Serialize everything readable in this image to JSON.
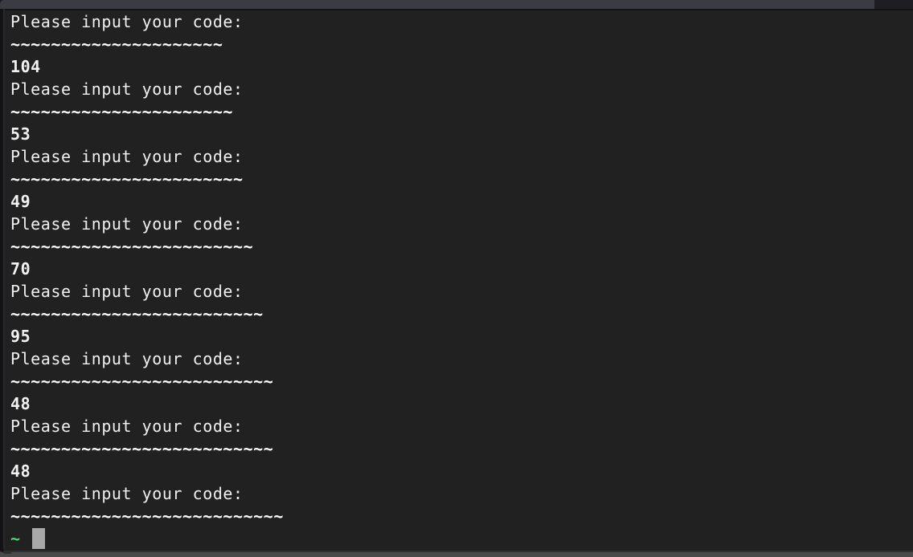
{
  "window": {
    "title": "",
    "background_color": "#212121",
    "titlebar_color": "#3b3b44",
    "titlebar_inactive_color": "#1d1d22",
    "text_color": "#e8e8e8",
    "prompt_color": "#4fd96b",
    "cursor_color": "#a8a8a8"
  },
  "terminal": {
    "prompt_text": "Please input your code:",
    "lines": [
      {
        "kind": "prompt",
        "text": "Please input your code:"
      },
      {
        "kind": "tilde",
        "text": "~~~~~~~~~~~~~~~~~~~~~"
      },
      {
        "kind": "value",
        "text": "104"
      },
      {
        "kind": "prompt",
        "text": "Please input your code:"
      },
      {
        "kind": "tilde",
        "text": "~~~~~~~~~~~~~~~~~~~~~~"
      },
      {
        "kind": "value",
        "text": "53"
      },
      {
        "kind": "prompt",
        "text": "Please input your code:"
      },
      {
        "kind": "tilde",
        "text": "~~~~~~~~~~~~~~~~~~~~~~~"
      },
      {
        "kind": "value",
        "text": "49"
      },
      {
        "kind": "prompt",
        "text": "Please input your code:"
      },
      {
        "kind": "tilde",
        "text": "~~~~~~~~~~~~~~~~~~~~~~~~"
      },
      {
        "kind": "value",
        "text": "70"
      },
      {
        "kind": "prompt",
        "text": "Please input your code:"
      },
      {
        "kind": "tilde",
        "text": "~~~~~~~~~~~~~~~~~~~~~~~~~"
      },
      {
        "kind": "value",
        "text": "95"
      },
      {
        "kind": "prompt",
        "text": "Please input your code:"
      },
      {
        "kind": "tilde",
        "text": "~~~~~~~~~~~~~~~~~~~~~~~~~~"
      },
      {
        "kind": "value",
        "text": "48"
      },
      {
        "kind": "prompt",
        "text": "Please input your code:"
      },
      {
        "kind": "tilde",
        "text": "~~~~~~~~~~~~~~~~~~~~~~~~~~"
      },
      {
        "kind": "value",
        "text": "48"
      },
      {
        "kind": "prompt",
        "text": "Please input your code:"
      },
      {
        "kind": "tilde",
        "text": "~~~~~~~~~~~~~~~~~~~~~~~~~~~"
      }
    ],
    "shell": {
      "sigil": "~",
      "command": "",
      "cursor": "block"
    }
  }
}
